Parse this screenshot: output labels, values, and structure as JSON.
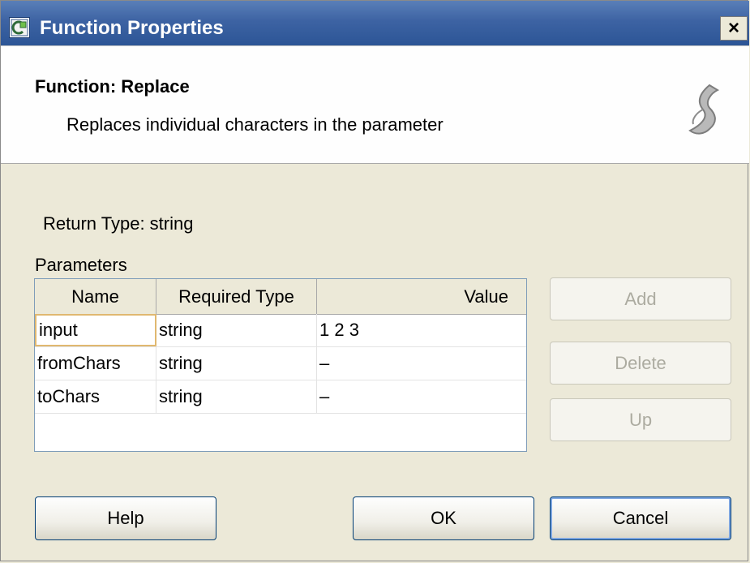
{
  "window": {
    "title": "Function Properties",
    "close_label": "×"
  },
  "header": {
    "function_name": "Function: Replace",
    "description": "Replaces individual characters in the parameter"
  },
  "return_type": "Return Type:  string",
  "params_label": "Parameters",
  "grid": {
    "columns": [
      "Name",
      "Required Type",
      "Value"
    ],
    "rows": [
      {
        "name": "input",
        "type": "string",
        "value": "1 2 3"
      },
      {
        "name": "fromChars",
        "type": "string",
        "value": "–"
      },
      {
        "name": "toChars",
        "type": "string",
        "value": "–"
      }
    ]
  },
  "side_buttons": {
    "add": "Add",
    "delete": "Delete",
    "up": "Up"
  },
  "buttons": {
    "help": "Help",
    "ok": "OK",
    "cancel": "Cancel"
  },
  "colors": {
    "titlebar": "#3d63a3",
    "dialog_bg": "#ece9d8",
    "focus_outline": "#e0b870"
  },
  "icons": {
    "app": "app-icon",
    "header": "scroll-icon",
    "close": "close-icon"
  }
}
